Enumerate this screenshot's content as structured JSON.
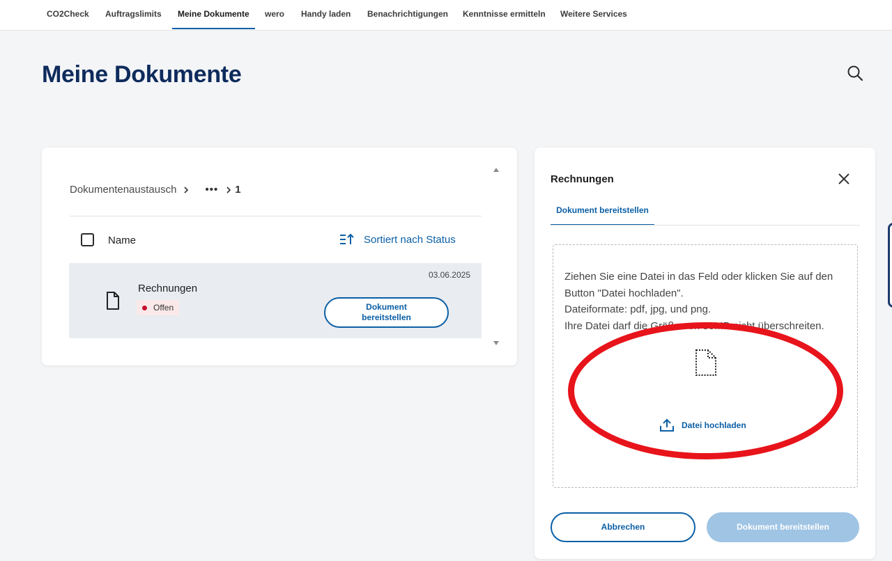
{
  "nav": {
    "tabs": [
      {
        "label": "CO2Check"
      },
      {
        "label": "Auftragslimits"
      },
      {
        "label": "Meine Dokumente"
      },
      {
        "label": "wero"
      },
      {
        "label": "Handy laden"
      },
      {
        "label": "Benachrichtigungen"
      },
      {
        "label": "Kenntnisse ermitteln"
      },
      {
        "label": "Weitere Services"
      }
    ],
    "active": "Meine Dokumente"
  },
  "page": {
    "title": "Meine Dokumente",
    "search_icon": "search-icon"
  },
  "documents": {
    "breadcrumb": {
      "root": "Dokumentenaustausch",
      "ellipsis": "•••",
      "current": "1"
    },
    "columns": {
      "name": "Name",
      "sort_label": "Sortiert nach Status"
    },
    "rows": [
      {
        "title": "Rechnungen",
        "date": "03.06.2025",
        "status": "Offen",
        "action_line1": "Dokument",
        "action_line2": "bereitstellen"
      }
    ]
  },
  "panel": {
    "title": "Rechnungen",
    "tab": "Dokument bereitstellen",
    "dropzone_lines": [
      "Ziehen Sie eine Datei in das Feld oder klicken Sie auf den Button \"Datei hochladen\".",
      "Dateiformate: pdf, jpg, und png.",
      "Ihre Datei darf die Größe von 50MB nicht überschreiten."
    ],
    "upload_label": "Datei hochladen",
    "cancel_label": "Abbrechen",
    "submit_label": "Dokument bereitstellen"
  },
  "colors": {
    "accent": "#0b5fa5",
    "title": "#0e2b5c",
    "status_dot": "#c8102e",
    "annotation": "#e8141b",
    "submit_disabled": "#9fc4e4"
  }
}
